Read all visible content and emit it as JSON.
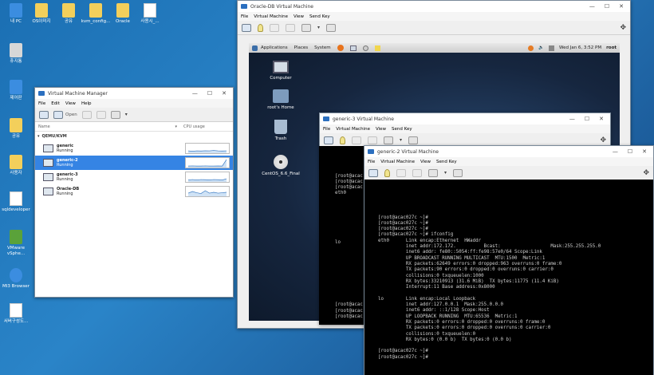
{
  "desktop": {
    "icons": [
      {
        "label": "내 PC",
        "icon": "computer-icon"
      },
      {
        "label": "휴지통",
        "icon": "recycle-bin-icon"
      },
      {
        "label": "제어판",
        "icon": "control-panel-icon"
      },
      {
        "label": "공유",
        "icon": "folder-icon"
      },
      {
        "label": "사용자",
        "icon": "user-folder-icon"
      },
      {
        "label": "sqldeveloper",
        "icon": "sqldeveloper-icon"
      },
      {
        "label": "VMware vSphe...",
        "icon": "vmware-icon"
      },
      {
        "label": "MI3 Browser",
        "icon": "browser-icon"
      },
      {
        "label": "서버구성도...",
        "icon": "document-icon"
      },
      {
        "label": "OS이미지",
        "icon": "folder-image-icon"
      },
      {
        "label": "공유",
        "icon": "folder-icon"
      },
      {
        "label": "kvm_config...",
        "icon": "folder-icon"
      },
      {
        "label": "Oracle",
        "icon": "folder-icon"
      },
      {
        "label": "사용시_...",
        "icon": "text-document-icon"
      }
    ]
  },
  "vmm": {
    "title": "Virtual Machine Manager",
    "menu": [
      "File",
      "Edit",
      "View",
      "Help"
    ],
    "toolbar_open": "Open",
    "col_name": "Name",
    "col_cpu": "CPU usage",
    "host": "QEMU/KVM",
    "vms": [
      {
        "name": "generic",
        "status": "Running",
        "selected": false,
        "cpu": [
          0.2,
          0.15,
          0.2,
          0.18,
          0.22,
          0.2,
          0.25,
          0.2,
          0.18,
          0.2
        ]
      },
      {
        "name": "generic-2",
        "status": "Running",
        "selected": true,
        "cpu": [
          0.1,
          0.12,
          0.1,
          0.1,
          0.12,
          0.1,
          0.1,
          0.11,
          0.1,
          0.9
        ]
      },
      {
        "name": "generic-3",
        "status": "Running",
        "selected": false,
        "cpu": [
          0.15,
          0.2,
          0.15,
          0.2,
          0.18,
          0.16,
          0.2,
          0.18,
          0.15,
          0.3
        ]
      },
      {
        "name": "Oracle-DB",
        "status": "Running",
        "selected": false,
        "cpu": [
          0.3,
          0.5,
          0.35,
          0.25,
          0.6,
          0.3,
          0.4,
          0.3,
          0.35,
          0.4
        ]
      }
    ]
  },
  "oracle_vm": {
    "title": "Oracle-DB Virtual Machine",
    "menu": [
      "File",
      "Virtual Machine",
      "View",
      "Send Key"
    ],
    "gnome": {
      "applications": "Applications",
      "places": "Places",
      "system": "System",
      "clock": "Wed Jan  6,  3:52 PM",
      "user": "root"
    },
    "guest_icons": [
      "Computer",
      "root's Home",
      "Trash",
      "CentOS_6.6_Final"
    ]
  },
  "generic3_vm": {
    "title": "generic-3 Virtual Machine",
    "menu": [
      "File",
      "Virtual Machine",
      "View",
      "Send Key"
    ],
    "terminal_top": "[root@acac\n[root@acac\n[root@acac\neth0",
    "terminal_lo": "lo",
    "terminal_bottom": "[root@acac\n[root@acac\n[root@acac"
  },
  "generic2_vm": {
    "title": "generic-2 Virtual Machine",
    "menu": [
      "File",
      "Virtual Machine",
      "View",
      "Send Key"
    ],
    "terminal": "[root@acac027c ~]#\n[root@acac027c ~]#\n[root@acac027c ~]#\n[root@acac027c ~]# ifconfig\neth0      Link encap:Ethernet  HWaddr\n          inet addr:172.172.          Bcast:                  Mask:255.255.255.0\n          inet6 addr: fe80::5054:ff:fe98:57e0/64 Scope:Link\n          UP BROADCAST RUNNING MULTICAST  MTU:1500  Metric:1\n          RX packets:62649 errors:0 dropped:963 overruns:0 frame:0\n          TX packets:90 errors:0 dropped:0 overruns:0 carrier:0\n          collisions:0 txqueuelen:1000\n          RX bytes:33210913 (31.6 MiB)  TX bytes:11775 (11.4 KiB)\n          Interrupt:11 Base address:0x8000\n\nlo        Link encap:Local Loopback\n          inet addr:127.0.0.1  Mask:255.0.0.0\n          inet6 addr: ::1/128 Scope:Host\n          UP LOOPBACK RUNNING  MTU:65536  Metric:1\n          RX packets:0 errors:0 dropped:0 overruns:0 frame:0\n          TX packets:0 errors:0 dropped:0 overruns:0 carrier:0\n          collisions:0 txqueuelen:0\n          RX bytes:0 (0.0 b)  TX bytes:0 (0.0 b)\n\n[root@acac027c ~]#\n[root@acac027c ~]#"
  }
}
